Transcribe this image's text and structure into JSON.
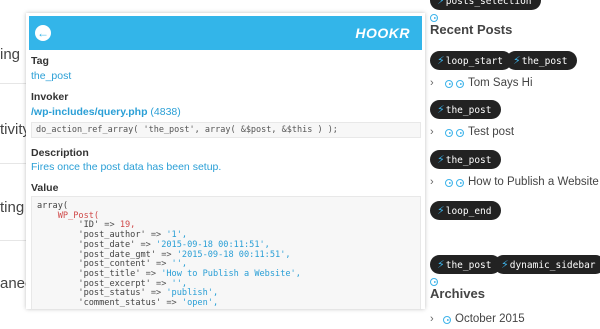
{
  "left_fragments": [
    "ing",
    "tivity",
    "ting",
    "aneo"
  ],
  "sidebar": {
    "top_pill": "posts_selection",
    "recent_posts_title": "Recent Posts",
    "hooks_row1": [
      "loop_start",
      "the_post"
    ],
    "post1": "Tom Says Hi",
    "hook_after_post1": "the_post",
    "post2": "Test post",
    "hook_after_post2": "the_post",
    "post3": "How to Publish a Website",
    "hook_loop_end": "loop_end",
    "hooks_row_bottom": [
      "the_post",
      "dynamic_sidebar"
    ],
    "archives_title": "Archives",
    "archive_item": "October 2015"
  },
  "popup": {
    "brand": "HOOKR",
    "back_icon": "arrow-left-icon",
    "tag_label": "Tag",
    "tag_value": "the_post",
    "invoker_label": "Invoker",
    "invoker_path": "/wp-includes/query.php",
    "invoker_line": "(4838)",
    "invoker_code": "do_action_ref_array( 'the_post', array( &$post, &$this ) );",
    "description_label": "Description",
    "description_value": "Fires once the post data has been setup.",
    "value_label": "Value",
    "value_lines": [
      {
        "indent": "",
        "key": "array(",
        "op": "",
        "val": "",
        "cls": "k"
      },
      {
        "indent": "    ",
        "key": "WP_Post(",
        "op": "",
        "val": "",
        "cls": "t"
      },
      {
        "indent": "        ",
        "key": "'ID'",
        "op": " => ",
        "val": "19,",
        "cls": "n"
      },
      {
        "indent": "        ",
        "key": "'post_author'",
        "op": " => ",
        "val": "'1',",
        "cls": "s"
      },
      {
        "indent": "        ",
        "key": "'post_date'",
        "op": " => ",
        "val": "'2015-09-18 00:11:51',",
        "cls": "s"
      },
      {
        "indent": "        ",
        "key": "'post_date_gmt'",
        "op": " => ",
        "val": "'2015-09-18 00:11:51',",
        "cls": "s"
      },
      {
        "indent": "        ",
        "key": "'post_content'",
        "op": " => ",
        "val": "'',",
        "cls": "s"
      },
      {
        "indent": "        ",
        "key": "'post_title'",
        "op": " => ",
        "val": "'How to Publish a Website',",
        "cls": "s"
      },
      {
        "indent": "        ",
        "key": "'post_excerpt'",
        "op": " => ",
        "val": "'',",
        "cls": "s"
      },
      {
        "indent": "        ",
        "key": "'post_status'",
        "op": " => ",
        "val": "'publish',",
        "cls": "s"
      },
      {
        "indent": "        ",
        "key": "'comment_status'",
        "op": " => ",
        "val": "'open',",
        "cls": "s"
      }
    ]
  },
  "colors": {
    "accent": "#33b5e9",
    "pill_bg": "#222222",
    "link_blue": "#2a9fd6"
  }
}
